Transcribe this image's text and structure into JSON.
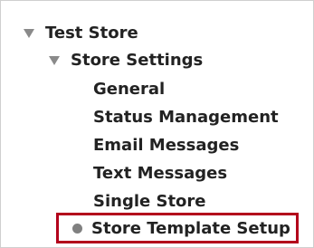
{
  "tree": {
    "root": {
      "label": "Test Store",
      "expander_icon": "triangle-down-icon",
      "expanded": true
    },
    "settings": {
      "label": "Store Settings",
      "expander_icon": "triangle-down-icon",
      "expanded": true
    },
    "items": [
      {
        "label": "General"
      },
      {
        "label": "Status Management"
      },
      {
        "label": "Email Messages"
      },
      {
        "label": "Text Messages"
      },
      {
        "label": "Single Store"
      },
      {
        "label": "Store Template Setup",
        "selected": true,
        "icon": "bullet-icon"
      }
    ]
  },
  "colors": {
    "text": "#222222",
    "expander": "#8a8a8a",
    "bullet": "#808080",
    "highlight_border": "#b3001b"
  }
}
